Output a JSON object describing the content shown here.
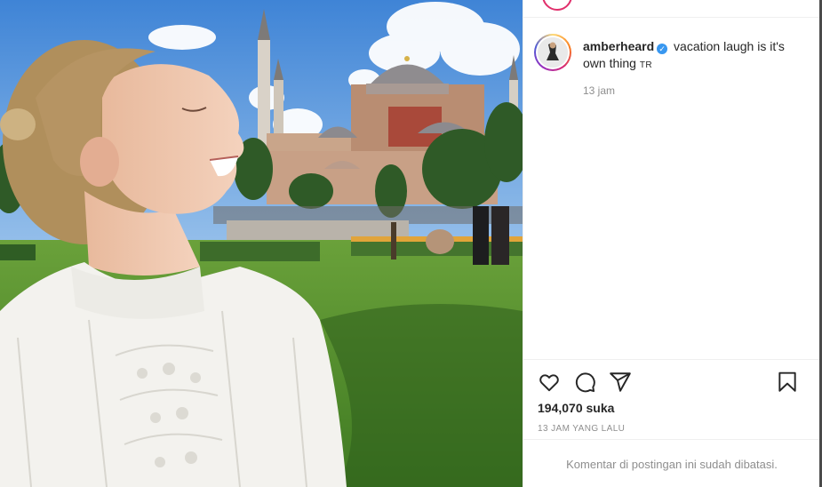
{
  "post": {
    "username": "amberheard",
    "verified_glyph": "✓",
    "caption": "vacation laugh is it's own thing",
    "caption_tag": "TR",
    "caption_time": "13 jam",
    "likes": "194,070 suka",
    "time_ago": "13 JAM YANG LALU",
    "comments_notice": "Komentar di postingan ini sudah dibatasi."
  },
  "icons": {
    "like": "heart-icon",
    "comment": "comment-bubble-icon",
    "share": "paper-plane-icon",
    "save": "bookmark-icon",
    "verified": "verified-badge-icon"
  },
  "colors": {
    "verified_blue": "#3897f0",
    "text": "#262626",
    "muted": "#8e8e8e",
    "divider": "#efefef"
  }
}
